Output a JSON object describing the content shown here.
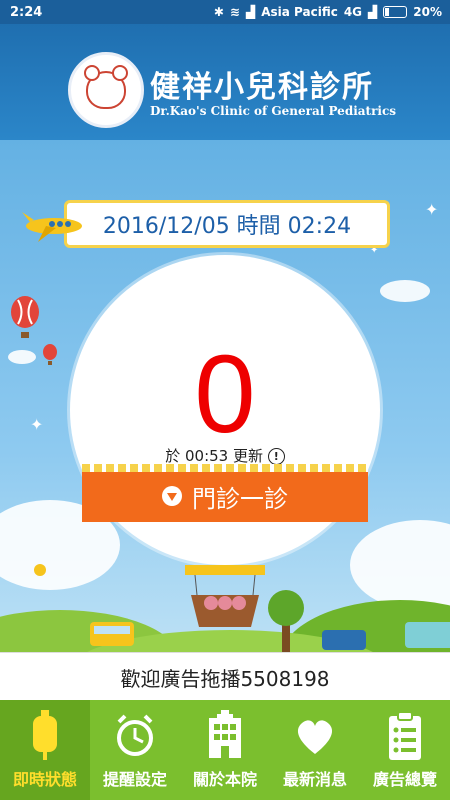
{
  "statusbar": {
    "time": "2:24",
    "carrier": "Asia Pacific",
    "network": "4G",
    "battery": "20%"
  },
  "header": {
    "title_cn": "健祥小兒科診所",
    "title_en": "Dr.Kao's Clinic of General Pediatrics"
  },
  "status": {
    "datetime": "2016/12/05 時間 02:24",
    "current_number": "0",
    "update_text": "於 00:53 更新",
    "clinic_label": "門診一診"
  },
  "ad": {
    "text": "歡迎廣告拖播5508198"
  },
  "tabs": [
    {
      "label": "即時狀態",
      "icon": "drip-bottle-icon"
    },
    {
      "label": "提醒設定",
      "icon": "alarm-clock-icon"
    },
    {
      "label": "關於本院",
      "icon": "hospital-icon"
    },
    {
      "label": "最新消息",
      "icon": "heart-icon"
    },
    {
      "label": "廣告總覽",
      "icon": "clipboard-icon"
    }
  ],
  "colors": {
    "header": "#1f6fb0",
    "accent": "#f26a1b",
    "number": "#e00000",
    "tabbar": "#7bbf2e",
    "active_tab_text": "#ffde2c"
  }
}
